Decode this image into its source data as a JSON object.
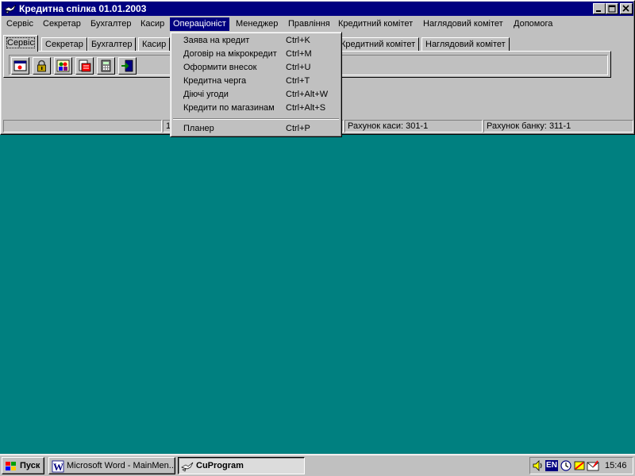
{
  "window": {
    "title": "Кредитна спілка 01.01.2003"
  },
  "menu_bar": {
    "items": [
      {
        "label": "Сервіс"
      },
      {
        "label": "Секретар"
      },
      {
        "label": "Бухгалтер"
      },
      {
        "label": "Касир"
      },
      {
        "label": "Операціоніст"
      },
      {
        "label": "Менеджер"
      },
      {
        "label": "Правління"
      },
      {
        "label": "Кредитний комітет"
      },
      {
        "label": "Наглядовий комітет"
      },
      {
        "label": "Допомога"
      }
    ]
  },
  "tabs": {
    "left": [
      {
        "label": "Сервіс"
      },
      {
        "label": "Секретар"
      },
      {
        "label": "Бухгалтер"
      },
      {
        "label": "Касир"
      }
    ],
    "right": [
      {
        "label": "Кредитний комітет"
      },
      {
        "label": "Наглядовий комітет"
      }
    ]
  },
  "toolbar": {
    "buttons": [
      {
        "icon": "window-icon"
      },
      {
        "icon": "lock-icon"
      },
      {
        "icon": "users-icon"
      },
      {
        "icon": "document-icon"
      },
      {
        "icon": "calculator-icon"
      },
      {
        "icon": "exit-door-icon"
      }
    ]
  },
  "status_bar": {
    "panel_1": "",
    "panel_2": "1",
    "cash_account": "Рахунок каси: 301-1",
    "bank_account": "Рахунок банку: 311-1"
  },
  "dropdown": {
    "items": [
      {
        "label": "Заява на кредит",
        "shortcut": "Ctrl+K"
      },
      {
        "label": "Договір на мікрокредит",
        "shortcut": "Ctrl+M"
      },
      {
        "label": "Оформити внесок",
        "shortcut": "Ctrl+U"
      },
      {
        "label": "Кредитна черга",
        "shortcut": "Ctrl+T"
      },
      {
        "label": "Діючі угоди",
        "shortcut": "Ctrl+Alt+W"
      },
      {
        "label": "Кредити по магазинам",
        "shortcut": "Ctrl+Alt+S"
      }
    ],
    "extra_item": {
      "label": "Планер",
      "shortcut": "Ctrl+P"
    }
  },
  "taskbar": {
    "start_label": "Пуск",
    "tasks": [
      {
        "label": "Microsoft Word - MainMen..."
      },
      {
        "label": "CuProgram"
      }
    ],
    "tray": {
      "language": "EN",
      "clock": "15:46"
    }
  }
}
